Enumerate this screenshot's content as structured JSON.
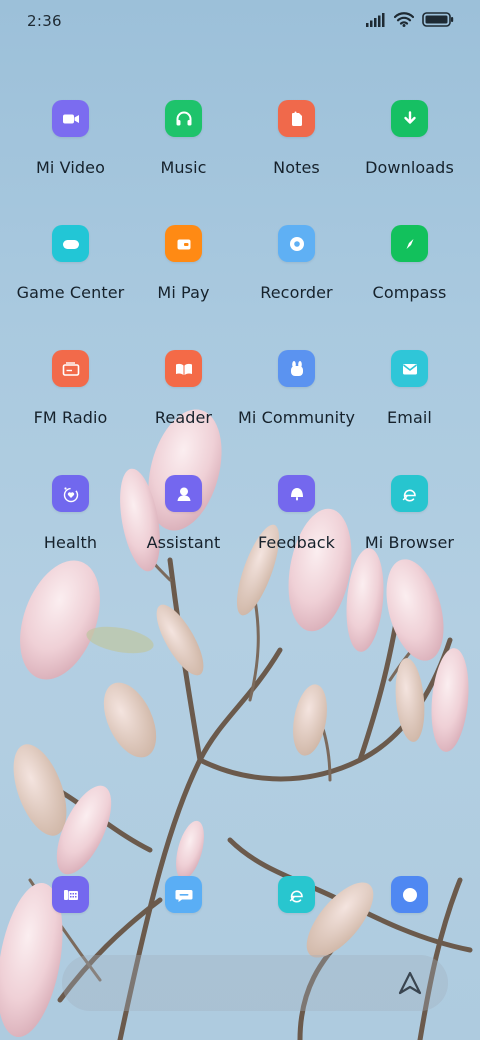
{
  "status_bar": {
    "time": "2:36",
    "icons": [
      "signal-icon",
      "wifi-icon",
      "battery-icon"
    ]
  },
  "apps": [
    {
      "label": "Mi Video",
      "icon": "video-camera-icon",
      "color": "#7b6cf0"
    },
    {
      "label": "Music",
      "icon": "headphones-icon",
      "color": "#1ec36b"
    },
    {
      "label": "Notes",
      "icon": "notes-icon",
      "color": "#f0694b"
    },
    {
      "label": "Downloads",
      "icon": "download-arrow-icon",
      "color": "#16c063"
    },
    {
      "label": "Game Center",
      "icon": "gamepad-icon",
      "color": "#22c6d6"
    },
    {
      "label": "Mi Pay",
      "icon": "wallet-icon",
      "color": "#ff8a14"
    },
    {
      "label": "Recorder",
      "icon": "record-disc-icon",
      "color": "#5fb0f4"
    },
    {
      "label": "Compass",
      "icon": "compass-needle-icon",
      "color": "#12c15c"
    },
    {
      "label": "FM Radio",
      "icon": "radio-icon",
      "color": "#f26a4a"
    },
    {
      "label": "Reader",
      "icon": "book-icon",
      "color": "#f46a47"
    },
    {
      "label": "Mi Community",
      "icon": "rabbit-icon",
      "color": "#5b93f0"
    },
    {
      "label": "Email",
      "icon": "envelope-icon",
      "color": "#2fc6d8"
    },
    {
      "label": "Health",
      "icon": "heart-icon",
      "color": "#7168ee"
    },
    {
      "label": "Assistant",
      "icon": "person-icon",
      "color": "#7467ef"
    },
    {
      "label": "Feedback",
      "icon": "bell-icon",
      "color": "#7468ee"
    },
    {
      "label": "Mi Browser",
      "icon": "browser-e-icon",
      "color": "#27c5cf"
    }
  ],
  "dock": [
    {
      "icon": "phone-icon",
      "color": "#7468ef"
    },
    {
      "icon": "messages-icon",
      "color": "#5aaef5"
    },
    {
      "icon": "browser-e-icon",
      "color": "#28c6cf"
    },
    {
      "icon": "camera-icon",
      "color": "#4f88f2"
    }
  ],
  "dock_extra_icon": "app-vault-icon"
}
